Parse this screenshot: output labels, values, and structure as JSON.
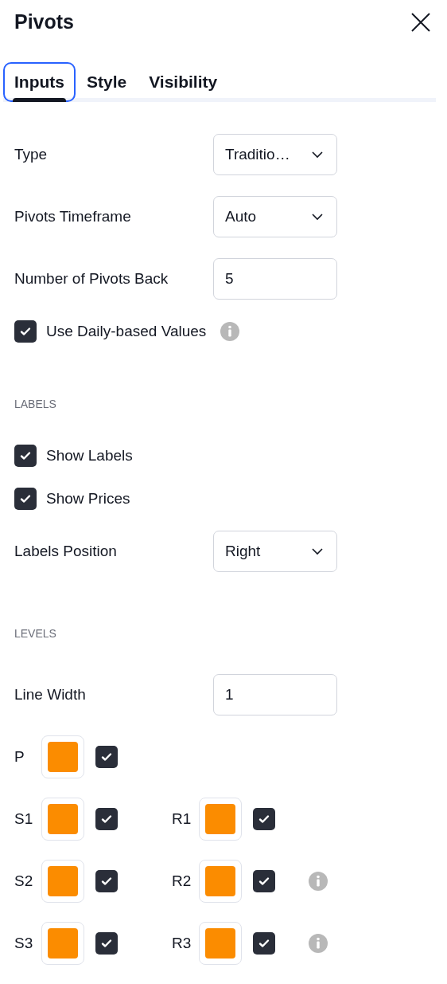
{
  "title": "Pivots",
  "tabs": [
    {
      "label": "Inputs",
      "selected": true
    },
    {
      "label": "Style",
      "selected": false
    },
    {
      "label": "Visibility",
      "selected": false
    }
  ],
  "sections": [
    {
      "rows": [
        {
          "kind": "select",
          "label": "Type",
          "value": "Traditio…"
        },
        {
          "kind": "select",
          "label": "Pivots Timeframe",
          "value": "Auto"
        },
        {
          "kind": "number",
          "label": "Number of Pivots Back",
          "value": "5"
        },
        {
          "kind": "checkbox",
          "label": "Use Daily-based Values",
          "checked": true,
          "info": true
        }
      ]
    },
    {
      "heading": "LABELS",
      "rows": [
        {
          "kind": "checkbox",
          "label": "Show Labels",
          "checked": true,
          "info": false
        },
        {
          "kind": "checkbox",
          "label": "Show Prices",
          "checked": true,
          "info": false
        },
        {
          "kind": "select",
          "label": "Labels Position",
          "value": "Right"
        }
      ]
    },
    {
      "heading": "LEVELS",
      "rows": [
        {
          "kind": "number",
          "label": "Line Width",
          "value": "1"
        }
      ]
    }
  ],
  "level_rows": [
    {
      "items": [
        {
          "label": "P",
          "color": "#fb8c00",
          "checked": true
        }
      ],
      "info": false
    },
    {
      "items": [
        {
          "label": "S1",
          "color": "#fb8c00",
          "checked": true
        },
        {
          "label": "R1",
          "color": "#fb8c00",
          "checked": true
        }
      ],
      "info": false
    },
    {
      "items": [
        {
          "label": "S2",
          "color": "#fb8c00",
          "checked": true
        },
        {
          "label": "R2",
          "color": "#fb8c00",
          "checked": true
        }
      ],
      "info": true
    },
    {
      "items": [
        {
          "label": "S3",
          "color": "#fb8c00",
          "checked": true
        },
        {
          "label": "R3",
          "color": "#fb8c00",
          "checked": true
        }
      ],
      "info": true
    }
  ]
}
